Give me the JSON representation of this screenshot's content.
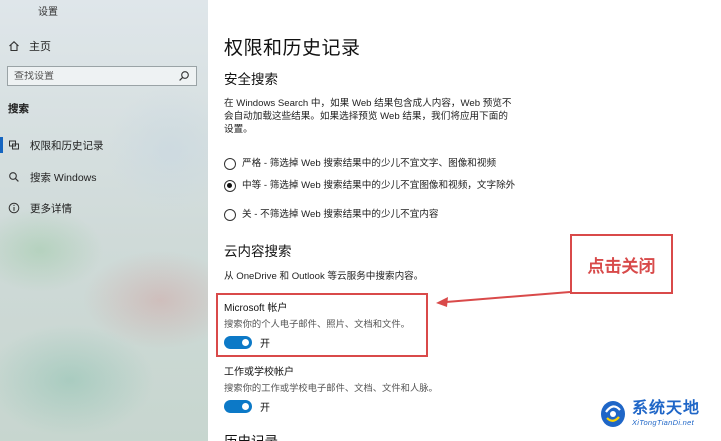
{
  "window": {
    "title": "设置"
  },
  "sidebar": {
    "home_label": "主页",
    "search_placeholder": "查找设置",
    "section_label": "搜索",
    "items": [
      {
        "label": "权限和历史记录",
        "icon": "permissions-icon",
        "active": true
      },
      {
        "label": "搜索 Windows",
        "icon": "search-icon",
        "active": false
      },
      {
        "label": "更多详情",
        "icon": "info-icon",
        "active": false
      }
    ]
  },
  "main": {
    "page_title": "权限和历史记录",
    "safe_search": {
      "heading": "安全搜索",
      "description_lines": [
        "在 Windows Search 中，如果 Web 结果包含成人内容，Web 预览不",
        "会自动加载这些结果。如果选择预览 Web 结果，我们将应用下面的",
        "设置。"
      ],
      "options": [
        {
          "text": "严格 - 筛选掉 Web 搜索结果中的少儿不宜文字、图像和视频",
          "selected": false
        },
        {
          "text": "中等 - 筛选掉 Web 搜索结果中的少儿不宜图像和视频，文字除外",
          "selected": true
        },
        {
          "text": "关 - 不筛选掉 Web 搜索结果中的少儿不宜内容",
          "selected": false
        }
      ]
    },
    "cloud_search": {
      "heading": "云内容搜索",
      "description": "从 OneDrive 和 Outlook 等云服务中搜索内容。",
      "microsoft_account": {
        "title": "Microsoft 帐户",
        "subtitle": "搜索你的个人电子邮件、照片、文档和文件。",
        "toggle_state": "开"
      },
      "work_account": {
        "title": "工作或学校帐户",
        "subtitle": "搜索你的工作或学校电子邮件、文档、文件和人脉。",
        "toggle_state": "开"
      }
    },
    "history_heading": "历史记录"
  },
  "annotation": {
    "callout_text": "点击关闭",
    "color": "#d94a4a"
  },
  "watermark": {
    "main": "系统天地",
    "sub": "XiTongTianDi.net"
  },
  "colors": {
    "accent": "#0c79c7",
    "sidebar_active": "#1565c0"
  }
}
